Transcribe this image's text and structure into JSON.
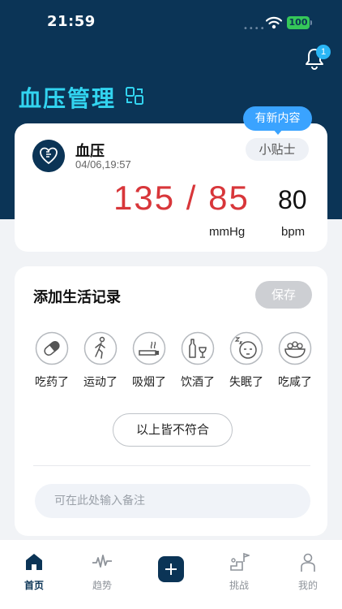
{
  "status_bar": {
    "time": "21:59",
    "battery": "100"
  },
  "header": {
    "title": "血压管理",
    "notification_count": "1"
  },
  "bp_card": {
    "label": "血压",
    "timestamp": "04/06,19:57",
    "tips_label": "小贴士",
    "new_content_label": "有新内容",
    "blood_pressure": "135 / 85",
    "pulse": "80",
    "bp_unit": "mmHg",
    "pulse_unit": "bpm"
  },
  "life_record": {
    "title": "添加生活记录",
    "save_label": "保存",
    "items": [
      {
        "label": "吃药了",
        "icon": "pill-icon"
      },
      {
        "label": "运动了",
        "icon": "walking-icon"
      },
      {
        "label": "吸烟了",
        "icon": "cigarette-icon"
      },
      {
        "label": "饮酒了",
        "icon": "wine-icon"
      },
      {
        "label": "失眠了",
        "icon": "sleep-face-icon"
      },
      {
        "label": "吃咸了",
        "icon": "salty-food-icon"
      }
    ],
    "none_label": "以上皆不符合",
    "note_placeholder": "可在此处输入备注"
  },
  "tabbar": {
    "items": [
      {
        "label": "首页",
        "icon": "home-icon",
        "active": true
      },
      {
        "label": "趋势",
        "icon": "trend-icon",
        "active": false
      },
      {
        "label": "",
        "icon": "add-icon",
        "active": false
      },
      {
        "label": "挑战",
        "icon": "challenge-icon",
        "active": false
      },
      {
        "label": "我的",
        "icon": "profile-icon",
        "active": false
      }
    ]
  },
  "colors": {
    "header_bg": "#0b3456",
    "title": "#32d4f0",
    "bp_value": "#d8363a",
    "badge": "#3aa3ff"
  }
}
